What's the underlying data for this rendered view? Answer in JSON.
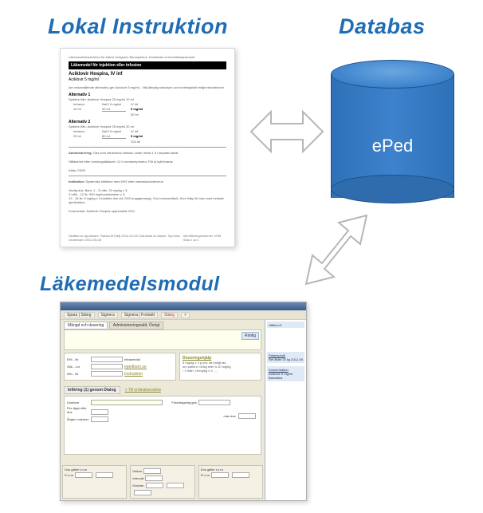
{
  "headings": {
    "lokal": "Lokal Instruktion",
    "databas": "Databas",
    "modul": "Läkemedelsmodul"
  },
  "database": {
    "label": "ePed"
  },
  "document": {
    "header_small": "Läkemedelsinstruktion för Astrid Lindgrens Barnsjukhus, Karolinska Universitetssjukhuset",
    "black_bar": "Läkemedel för injektion eller infusion",
    "drug_title": "Aciklovir Hospira, IV inf",
    "drug_sub": "Aciklovir 5 mg/ml",
    "intro": "(se nedanstående alternativ) ger Aciclovir 5 mg/ml - Välj lämplig slutvolym och iordningställ enligt instruktionen",
    "alt1_title": "Alternativ 1",
    "alt1_desc": "Spädes från: Aciklovir Hospira 25 mg/ml 10 ml",
    "alt1_rows": [
      [
        "Infusion",
        "NaCl 9 mg/ml",
        "IV inf"
      ],
      [
        "10 ml",
        "40 ml",
        "5 mg/ml"
      ],
      [
        "",
        "",
        "50 ml"
      ]
    ],
    "alt2_title": "Alternativ 2",
    "alt2_desc": "Spädes från: Aciklovir Hospira 25 mg/ml 20 ml",
    "alt2_rows": [
      [
        "Infusion",
        "NaCl 9 mg/ml",
        "IV inf"
      ],
      [
        "20 ml",
        "80 ml",
        "5 mg/ml"
      ],
      [
        "",
        "",
        "100 ml"
      ]
    ],
    "admin_title": "Administrering:",
    "admin_text": "Ges som intravenös infusion under minst 1 h i separat kanal",
    "hallbarhet": "Hållbarhet efter iordningställande: 12 h rumstemperatur. Får ej kylförvaras",
    "kalla": "Källa: FASS",
    "indikation_title": "Indikation:",
    "indikation_text": "Systemisk infektion med HSV eller varicella/zostervirus",
    "dos_lines": [
      "Vanlig dos: Barn: 1 - 3 mån: 20 mg/kg x 3,",
      "3 mån - 12 år: 500 mg/kvadratmeter x 3,",
      "12 - 18 år: 5 mg/kg x 3 (dubbla dos vid CNS-engagemang). Sno heresantibel). Kom ihåg för barn med nedsatt njurfunktion"
    ],
    "kommentar": "Kommentar: Aciklovir Hospira upphandlat 2011",
    "footer_left": "Skaffad av apotekare: Ranaa M Rafij 2011-02-28\nGranskad av läkare: Synnöve Lindemalm 2011-05-08",
    "footer_right": "Identifieringsnummer 3765\nSida 1 av 1"
  },
  "module": {
    "toolbar": {
      "spara": "Spara | Stäng",
      "signera": "Signera",
      "signera_fortsatt": "Signera | Fortsätt",
      "stang": "Stäng",
      "makuler": "×"
    },
    "tabs": {
      "dosering": "Mängd och dosering",
      "admsatt": "Administreringssätt, Övrigt"
    },
    "rimlig_btn": "Rimlig",
    "fields": {
      "ehid_lbl": "EHI - Nr",
      "sok_lbl": "Sök - Lnr",
      "info_lbl": "Info - Nr",
      "instruktion": "Instruktion",
      "ehid_val": "Intravenöst",
      "sok_val": "epedbarn.se",
      "devs": "Doseringshjälp",
      "till_link": "> Till ordinationslista",
      "inforing_title": "Införing (1) genom Dialog",
      "dos_lbl": "Dosform",
      "per_dygn_lbl": "Per dygn eller dos",
      "ange_lbl": "Ången volymen",
      "max_dos_lbl": "max dos",
      "dos_galler_lbl": "Dos gäller t.o.m",
      "fran_lbl": "Fr.o.m",
      "datum_lbl": "Datum",
      "intervall_lbl": "Intervall",
      "klockan_lbl": "Klockan"
    },
    "side_bar": {
      "halt": "Hållet pH",
      "profil_lbl": "Patientprofil",
      "ref_alder": "Ref ålder",
      "ref_alder_val": "20 kg",
      "date": "2012-05",
      "koncentration": "Koncentration",
      "beredning": "Aciklovir 5 mg/ml Basväska"
    }
  }
}
